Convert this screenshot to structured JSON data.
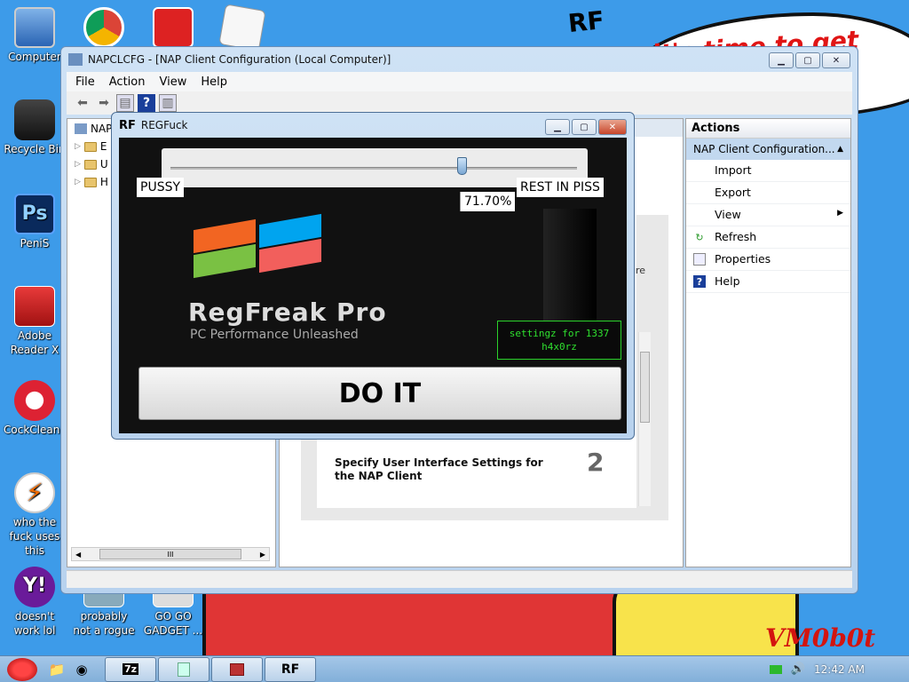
{
  "desktop": {
    "wallpaper_banner": "it's time to get shit new",
    "rf_logo": "RF",
    "signature": "VM0b0t",
    "icons": [
      {
        "label": "Computer",
        "icon": "computer-icon"
      },
      {
        "label": "",
        "icon": "chrome-icon"
      },
      {
        "label": "",
        "icon": "angry-birds-icon"
      },
      {
        "label": "",
        "icon": "document-icon"
      },
      {
        "label": "Recycle Bin",
        "icon": "recycle-bin-icon"
      },
      {
        "label": "PeniS",
        "icon": "photoshop-icon"
      },
      {
        "label": "Adobe Reader X",
        "icon": "adobe-reader-icon"
      },
      {
        "label": "CockCleaner",
        "icon": "ccleaner-icon"
      },
      {
        "label": "who the fuck uses this",
        "icon": "lightning-icon"
      },
      {
        "label": "doesn't work lol",
        "icon": "yahoo-icon"
      },
      {
        "label": "probably not a rogue",
        "icon": "box-icon"
      },
      {
        "label": "GO GO GADGET ...",
        "icon": "gadget-icon"
      }
    ]
  },
  "mmc": {
    "title": "NAPCLCFG - [NAP Client Configuration (Local Computer)]",
    "menu": [
      "File",
      "Action",
      "View",
      "Help"
    ],
    "tree_root": "NAP",
    "tree_items": [
      "E",
      "U",
      "H"
    ],
    "center_text": "ure",
    "step_text": "Specify User Interface Settings for the NAP Client",
    "step_number": "2",
    "hscroll_grip": "III",
    "actions": {
      "header": "Actions",
      "section": "NAP Client Configuration...",
      "items": [
        {
          "label": "Import",
          "icon": ""
        },
        {
          "label": "Export",
          "icon": ""
        },
        {
          "label": "View",
          "icon": "submenu-arrow-icon"
        },
        {
          "label": "Refresh",
          "icon": "refresh-icon"
        },
        {
          "label": "Properties",
          "icon": "properties-icon"
        },
        {
          "label": "Help",
          "icon": "help-icon"
        }
      ]
    }
  },
  "regfuck": {
    "title": "REGFuck",
    "title_icon": "RF",
    "slider_min_label": "PUSSY",
    "slider_max_label": "REST IN PISS",
    "slider_percent_text": "71.70%",
    "slider_value": 0.717,
    "product_name": "RegFreak Pro",
    "product_tagline": "PC Performance Unleashed",
    "settings_line1": "settingz for 1337",
    "settings_line2": "h4x0rz",
    "do_it_label": "DO IT"
  },
  "taskbar": {
    "clock": "12:42 AM",
    "task_buttons": [
      "7z",
      "",
      "",
      "RF"
    ]
  }
}
